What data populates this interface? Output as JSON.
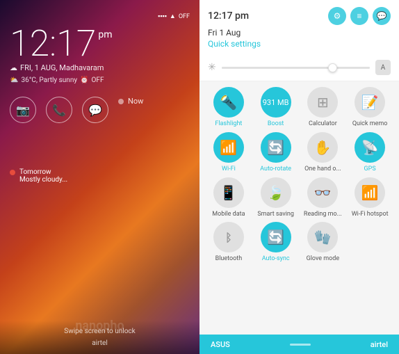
{
  "lockscreen": {
    "time": "12:17",
    "ampm": "pm",
    "date": "FRI, 1 AUG, Madhavaram",
    "temperature": "36°C, Partly sunny",
    "alarm": "OFF",
    "apps": [
      {
        "icon": "📷",
        "name": "camera"
      },
      {
        "icon": "📞",
        "name": "phone"
      },
      {
        "icon": "💬",
        "name": "messages"
      }
    ],
    "now_label": "Now",
    "tomorrow_label": "Tomorrow",
    "tomorrow_sub": "Mostly cloudy...",
    "unlock_text": "Swipe screen to unlock",
    "carrier": "airtel",
    "watermark": "nanopho"
  },
  "quicksettings": {
    "time": "12:17 pm",
    "date": "Fri 1 Aug",
    "quick_label": "Quick settings",
    "header_icons": [
      {
        "name": "settings-icon",
        "symbol": "⚙"
      },
      {
        "name": "notes-icon",
        "symbol": "📋"
      },
      {
        "name": "chat-icon",
        "symbol": "💬"
      }
    ],
    "grid_rows": [
      [
        {
          "label": "Flashlight",
          "icon": "🔦",
          "active": true
        },
        {
          "label": "Boost",
          "icon": "🚀",
          "active": true,
          "badge": "931 MB"
        },
        {
          "label": "Calculator",
          "icon": "⊞",
          "active": false
        },
        {
          "label": "Quick memo",
          "icon": "📝",
          "active": false
        }
      ],
      [
        {
          "label": "Wi-Fi",
          "icon": "📶",
          "active": true
        },
        {
          "label": "Auto-rotate",
          "icon": "🔄",
          "active": true
        },
        {
          "label": "One hand o...",
          "icon": "✋",
          "active": false
        },
        {
          "label": "GPS",
          "icon": "📡",
          "active": true
        }
      ],
      [
        {
          "label": "Mobile data",
          "icon": "📱",
          "active": false
        },
        {
          "label": "Smart saving",
          "icon": "🍃",
          "active": false
        },
        {
          "label": "Reading mo...",
          "icon": "👓",
          "active": false
        },
        {
          "label": "Wi-Fi hotspot",
          "icon": "📡",
          "active": false
        }
      ],
      [
        {
          "label": "Bluetooth",
          "icon": "🔵",
          "active": false
        },
        {
          "label": "Auto-sync",
          "icon": "🔄",
          "active": true
        },
        {
          "label": "Glove mode",
          "icon": "🧤",
          "active": false
        }
      ]
    ],
    "bottom_bar": {
      "left": "ASUS",
      "right": "airtel"
    }
  }
}
